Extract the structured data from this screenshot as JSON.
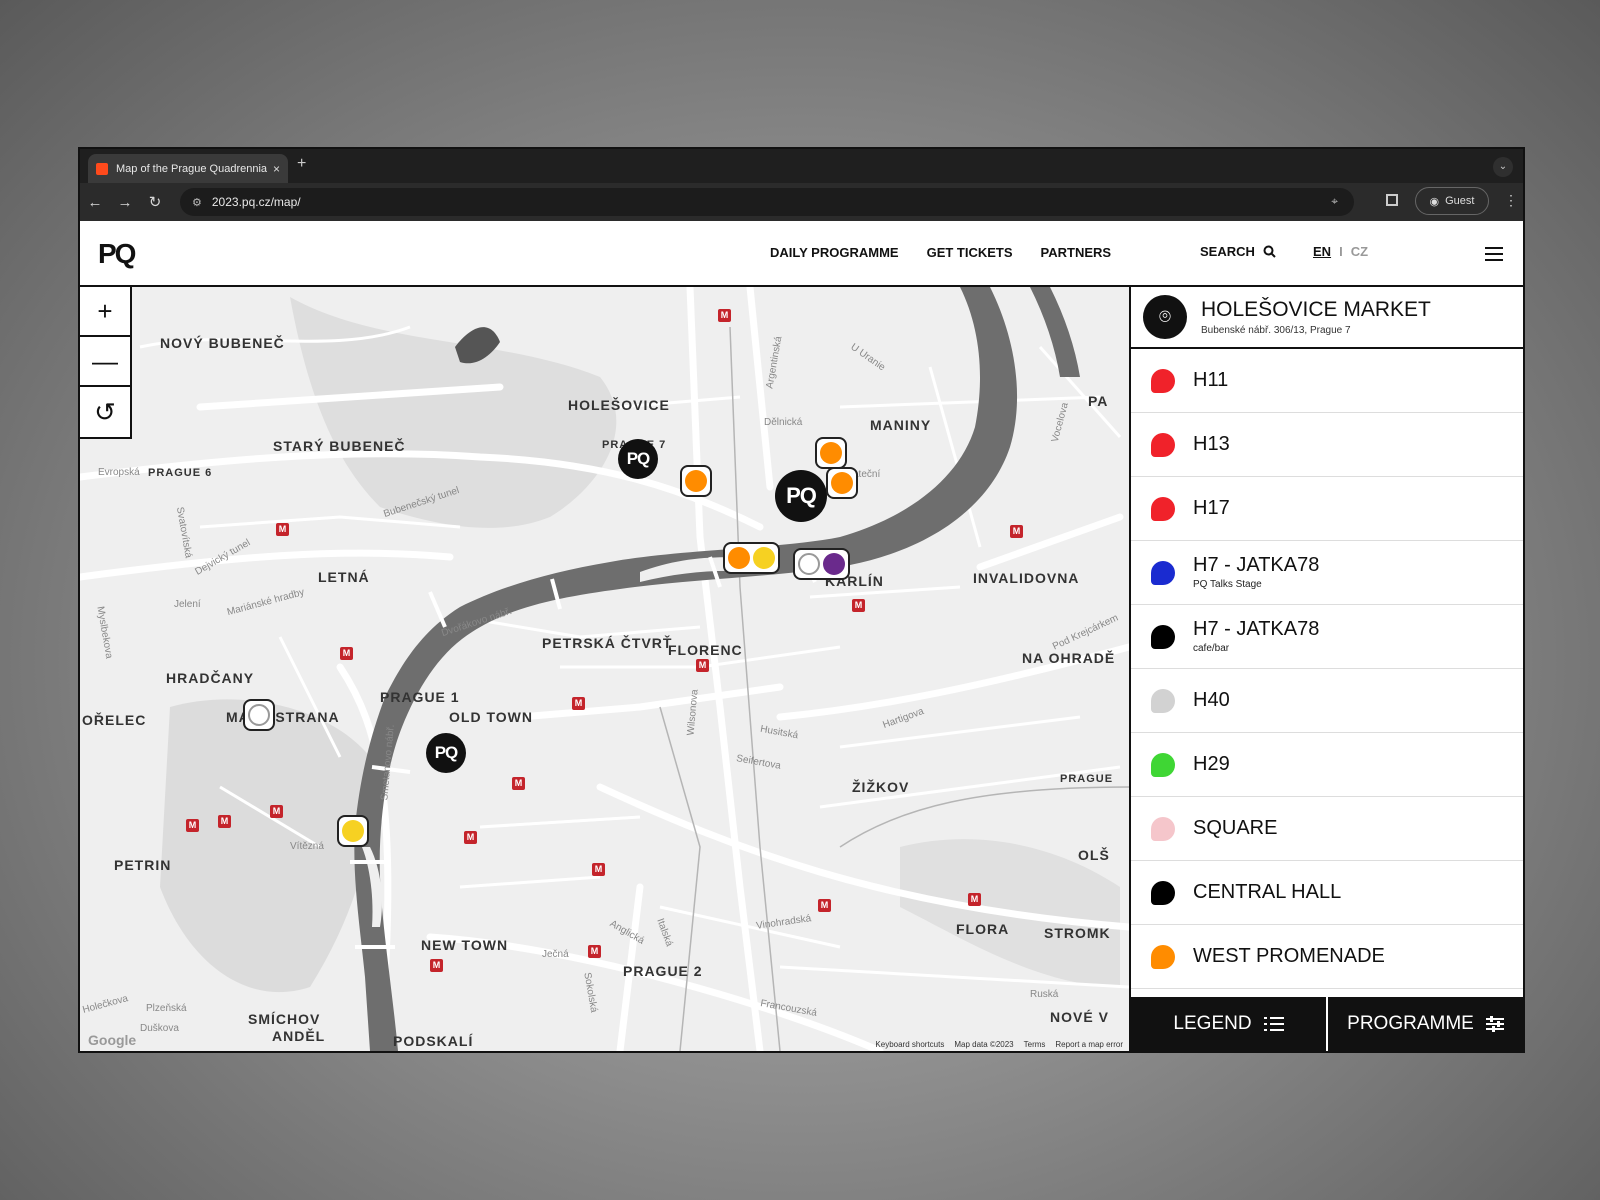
{
  "browser": {
    "tab_title": "Map of the Prague Quadrennial",
    "tab_close": "×",
    "new_tab": "+",
    "url": "2023.pq.cz/map/",
    "profile_label": "Guest"
  },
  "site": {
    "logo": "PQ",
    "nav": [
      "DAILY PROGRAMME",
      "GET TICKETS",
      "PARTNERS"
    ],
    "search_label": "SEARCH",
    "lang_active": "EN",
    "lang_sep": "I",
    "lang_other": "CZ"
  },
  "map": {
    "districts": [
      "NOVÝ BUBENEČ",
      "HOLEŠOVICE",
      "STARÝ BUBENEČ",
      "PRAGUE 6",
      "MANINY",
      "LETNÁ",
      "KARLÍN",
      "INVALIDOVNA",
      "PETRSKÁ ČTVRŤ",
      "FLORENC",
      "NA OHRADĚ",
      "HRADČANY",
      "PRAGUE 1",
      "OLD TOWN",
      "MALÁ STRANA",
      "OŘELEC",
      "ŽIŽKOV",
      "PRAGUE",
      "PETRIN",
      "OLŠ",
      "FLORA",
      "STROMK",
      "NEW TOWN",
      "PRAGUE 2",
      "NOVÉ V",
      "SMÍCHOV",
      "ANDĚL",
      "PODSKALÍ",
      "PRAGUE 7",
      "PA"
    ],
    "streets": [
      "Argentinská",
      "U Uranie",
      "Dělnická",
      "Jateční",
      "Bubenečský tunel",
      "Dejvický tunel",
      "Evropská",
      "Svatovítská",
      "Mariánské hradby",
      "Dvořákovo nábř.",
      "Wilsonova",
      "Husitská",
      "Seifertova",
      "Hartigova",
      "Vinohradská",
      "Anglická",
      "Italská",
      "Ječná",
      "Sokolská",
      "Francouzská",
      "Ruská",
      "Vítězná",
      "Holečkova",
      "Plzeňská",
      "Duškova",
      "Smetanovo nábř.",
      "Vocelova",
      "Pod Krejcárkem",
      "Jelení",
      "Myslbekova"
    ],
    "footer": [
      "Keyboard shortcuts",
      "Map data ©2023",
      "Terms",
      "Report a map error"
    ],
    "google": "Google",
    "zoom_in": "+",
    "zoom_out": "—",
    "reset": "↺",
    "pq_marker": "PQ"
  },
  "panel": {
    "venue_title": "HOLEŠOVICE MARKET",
    "venue_address": "Bubenské nábř. 306/13, Prague 7",
    "halls": [
      {
        "label": "H11",
        "sub": "",
        "color": "#f0222a"
      },
      {
        "label": "H13",
        "sub": "",
        "color": "#f0222a"
      },
      {
        "label": "H17",
        "sub": "",
        "color": "#f0222a"
      },
      {
        "label": "H7 - JATKA78",
        "sub": "PQ Talks Stage",
        "color": "#1a2bd0"
      },
      {
        "label": "H7 - JATKA78",
        "sub": "cafe/bar",
        "color": "#000000"
      },
      {
        "label": "H40",
        "sub": "",
        "color": "#d2d2d2"
      },
      {
        "label": "H29",
        "sub": "",
        "color": "#3fd634"
      },
      {
        "label": "SQUARE",
        "sub": "",
        "color": "#f5c6cb"
      },
      {
        "label": "CENTRAL HALL",
        "sub": "",
        "color": "#000000"
      },
      {
        "label": "WEST PROMENADE",
        "sub": "",
        "color": "#ff8c00"
      }
    ],
    "legend_label": "LEGEND",
    "programme_label": "PROGRAMME"
  }
}
